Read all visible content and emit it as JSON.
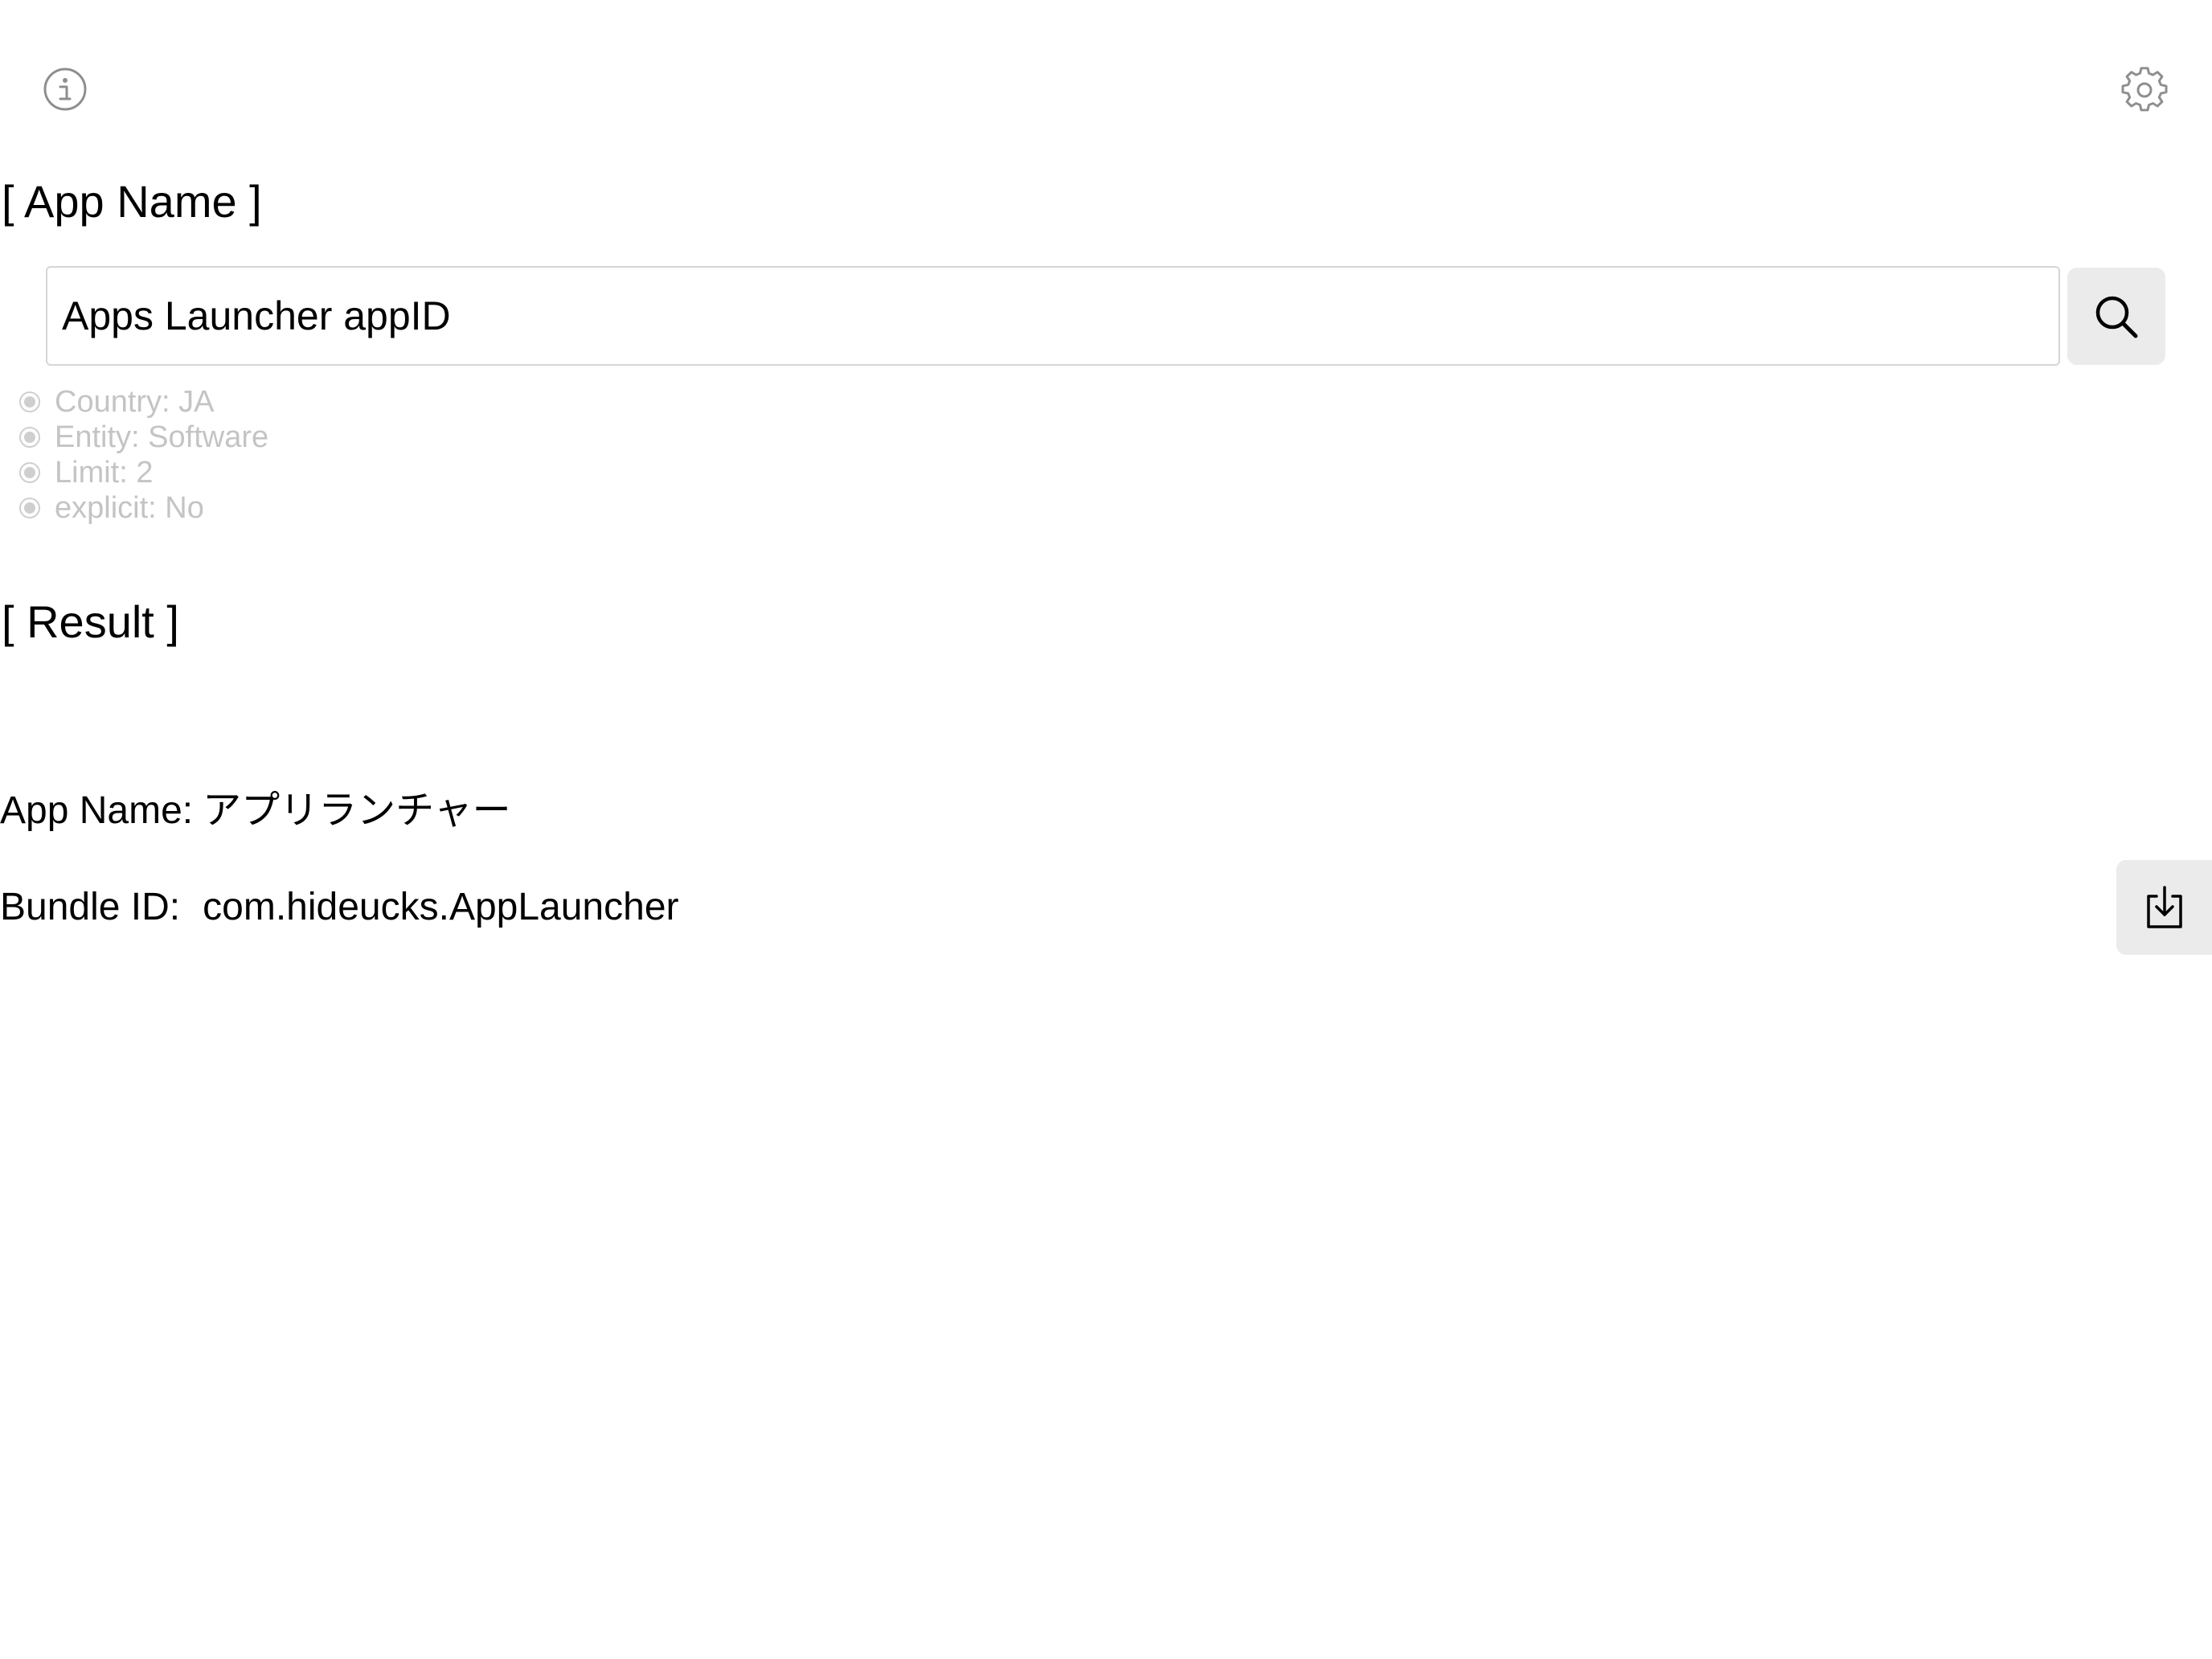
{
  "header": {
    "info_icon": "info-icon",
    "settings_icon": "gear-icon"
  },
  "app_name_section": {
    "title": "[ App Name ]",
    "search_value": "Apps Launcher appID",
    "search_icon": "search-icon"
  },
  "options": [
    {
      "label": "Country: JA",
      "selected": true
    },
    {
      "label": "Entity: Software",
      "selected": true
    },
    {
      "label": "Limit: 2",
      "selected": true
    },
    {
      "label": "explicit: No",
      "selected": true
    }
  ],
  "result_section": {
    "title": "[ Result ]",
    "app_name_label": "App Name:",
    "app_name_value": "アプリランチャー",
    "bundle_id_label": "Bundle ID:",
    "bundle_id_value": "com.hideucks.AppLauncher",
    "download_icon": "download-icon"
  },
  "colors": {
    "icon_gray": "#8e8e8e",
    "button_bg": "#ebebeb",
    "option_text": "#c4c4c4",
    "field_border": "#d6d6d6"
  }
}
